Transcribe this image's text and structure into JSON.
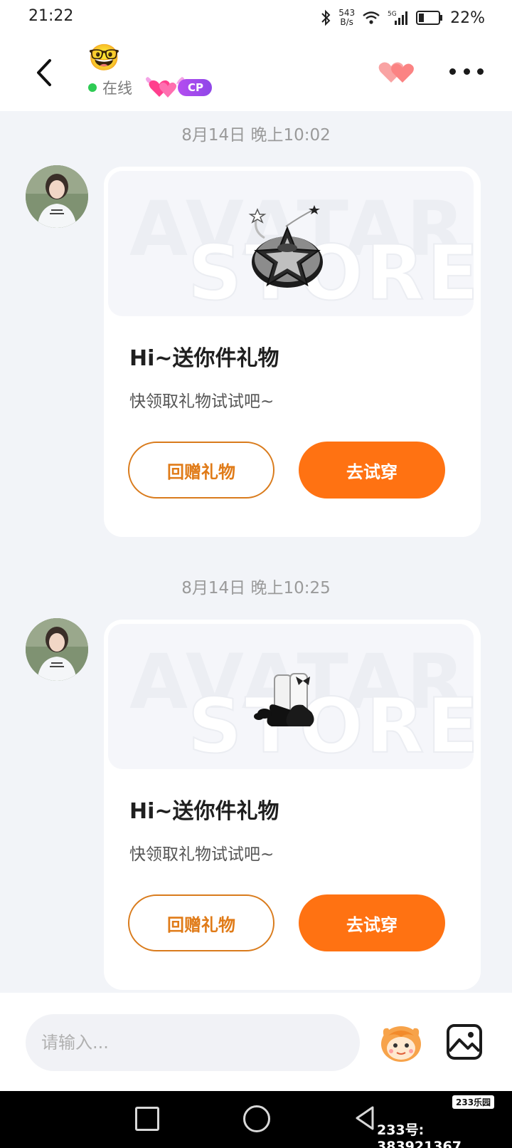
{
  "status_bar": {
    "time": "21:22",
    "net_speed_value": "543",
    "net_speed_unit": "B/s",
    "network": "5G",
    "battery": "22%"
  },
  "header": {
    "avatar_emoji": "🤓",
    "online_status": "在线",
    "cp_badge": "CP"
  },
  "messages": [
    {
      "timestamp": "8月14日 晚上10:02",
      "banner_watermark_1": "AVATAR",
      "banner_watermark_2": "STORE",
      "item_icon": "star-hat-icon",
      "title": "Hi~送你件礼物",
      "subtitle": "快领取礼物试试吧~",
      "return_button": "回赠礼物",
      "try_button": "去试穿"
    },
    {
      "timestamp": "8月14日 晚上10:25",
      "banner_watermark_1": "AVATAR",
      "banner_watermark_2": "STORE",
      "item_icon": "shoes-icon",
      "title": "Hi~送你件礼物",
      "subtitle": "快领取礼物试试吧~",
      "return_button": "回赠礼物",
      "try_button": "去试穿"
    }
  ],
  "input": {
    "placeholder": "请输入..."
  },
  "watermark": {
    "logo": "233乐园",
    "id_text": "233号: 383921367"
  },
  "colors": {
    "accent": "#ff7212",
    "accent_outline": "#d97b1c",
    "online": "#2ecb54",
    "cp": "#9b4cf0"
  }
}
